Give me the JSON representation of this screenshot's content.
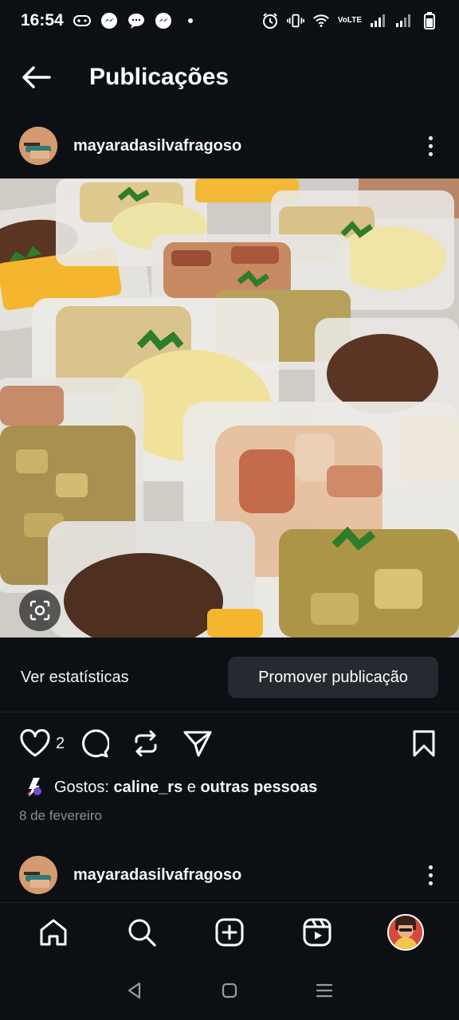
{
  "status_bar": {
    "time": "16:54",
    "network_label": "VoLTE"
  },
  "header": {
    "title": "Publicações"
  },
  "post": {
    "username": "mayaradasilvafragoso",
    "view_stats_label": "Ver estatísticas",
    "promote_label": "Promover publicação",
    "like_count": "2",
    "likes_prefix": "Gostos: ",
    "likes_user": "caline_rs",
    "likes_joiner": " e ",
    "likes_others": "outras pessoas",
    "date": "8 de fevereiro"
  },
  "next_post": {
    "username": "mayaradasilvafragoso"
  },
  "icons": {
    "back": "arrow-left-icon",
    "more": "more-vertical-icon",
    "like": "heart-icon",
    "comment": "comment-icon",
    "repost": "repost-icon",
    "share": "send-icon",
    "save": "bookmark-icon",
    "lens": "visual-search-icon",
    "nav": [
      "home-icon",
      "search-icon",
      "create-icon",
      "reels-icon",
      "profile-avatar"
    ]
  },
  "colors": {
    "background": "#0c1014",
    "button": "#262a30",
    "muted_text": "#8e8e8e"
  }
}
